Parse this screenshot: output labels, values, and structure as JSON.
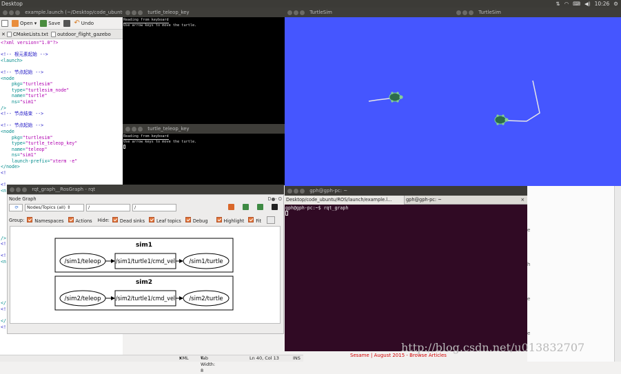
{
  "topbar": {
    "title": "Desktop",
    "time": "10:26"
  },
  "gedit": {
    "title": "example.launch (~/Desktop/code_ubuntu",
    "toolbar": {
      "open": "Open",
      "save": "Save",
      "undo": "Undo"
    },
    "tabs": [
      "CMakeLists.txt",
      "outdoor_flight_gazebo"
    ],
    "lines": [
      [
        [
          "<?xml version=\"1.0\"?>",
          "c-attr"
        ]
      ],
      [
        [
          "",
          ""
        ]
      ],
      [
        [
          "<!-- ",
          "c-cmt"
        ],
        [
          "根元素起始",
          "c-cmt"
        ],
        [
          " -->",
          "c-cmt"
        ]
      ],
      [
        [
          "<launch>",
          "c-tag"
        ]
      ],
      [
        [
          "",
          ""
        ]
      ],
      [
        [
          "<!-- ",
          "c-cmt"
        ],
        [
          "节点起始",
          "c-cmt"
        ],
        [
          " -->",
          "c-cmt"
        ]
      ],
      [
        [
          "<node",
          "c-tag"
        ]
      ],
      [
        [
          "    pkg=",
          "c-tag"
        ],
        [
          "\"turtlesim\"",
          "c-attr"
        ]
      ],
      [
        [
          "    type=",
          "c-tag"
        ],
        [
          "\"turtlesim_node\"",
          "c-attr"
        ]
      ],
      [
        [
          "    name=",
          "c-tag"
        ],
        [
          "\"turtle\"",
          "c-attr"
        ]
      ],
      [
        [
          "    ns=",
          "c-tag"
        ],
        [
          "\"sim1\"",
          "c-attr"
        ]
      ],
      [
        [
          "/>",
          "c-tag"
        ]
      ],
      [
        [
          "<!-- ",
          "c-cmt"
        ],
        [
          "节点结束",
          "c-cmt"
        ],
        [
          " -->",
          "c-cmt"
        ]
      ],
      [
        [
          "",
          ""
        ]
      ],
      [
        [
          "<!-- ",
          "c-cmt"
        ],
        [
          "节点起始",
          "c-cmt"
        ],
        [
          " -->",
          "c-cmt"
        ]
      ],
      [
        [
          "<node",
          "c-tag"
        ]
      ],
      [
        [
          "    pkg=",
          "c-tag"
        ],
        [
          "\"turtlesim\"",
          "c-attr"
        ]
      ],
      [
        [
          "    type=",
          "c-tag"
        ],
        [
          "\"turtle_teleop_key\"",
          "c-attr"
        ]
      ],
      [
        [
          "    name=",
          "c-tag"
        ],
        [
          "\"teleop\"",
          "c-attr"
        ]
      ],
      [
        [
          "    ns=",
          "c-tag"
        ],
        [
          "\"sim1\"",
          "c-attr"
        ]
      ],
      [
        [
          "    launch-prefix=",
          "c-tag"
        ],
        [
          "\"xterm -e\"",
          "c-attr"
        ]
      ],
      [
        [
          "</node>",
          "c-tag"
        ]
      ],
      [
        [
          "<!",
          "c-cmt"
        ]
      ],
      [
        [
          "",
          ""
        ]
      ],
      [
        [
          "<!",
          "c-cmt"
        ]
      ],
      [
        [
          "<n",
          "c-tag"
        ]
      ],
      [
        [
          "",
          ""
        ]
      ],
      [
        [
          "",
          ""
        ]
      ],
      [
        [
          "",
          ""
        ]
      ],
      [
        [
          "",
          ""
        ]
      ],
      [
        [
          "",
          ""
        ]
      ],
      [
        [
          "",
          ""
        ]
      ],
      [
        [
          "",
          ""
        ]
      ],
      [
        [
          "/>",
          "c-tag"
        ]
      ],
      [
        [
          "<!",
          "c-cmt"
        ]
      ],
      [
        [
          "",
          ""
        ]
      ],
      [
        [
          "<!",
          "c-cmt"
        ]
      ],
      [
        [
          "<n",
          "c-tag"
        ]
      ],
      [
        [
          "",
          ""
        ]
      ],
      [
        [
          "",
          ""
        ]
      ],
      [
        [
          "",
          ""
        ]
      ],
      [
        [
          "",
          ""
        ]
      ],
      [
        [
          "",
          ""
        ]
      ],
      [
        [
          "",
          ""
        ]
      ],
      [
        [
          "</",
          "c-tag"
        ]
      ],
      [
        [
          "<!",
          "c-cmt"
        ]
      ],
      [
        [
          "",
          ""
        ]
      ],
      [
        [
          "</",
          "c-tag"
        ]
      ],
      [
        [
          "<!",
          "c-cmt"
        ]
      ]
    ],
    "status": {
      "lang": "XML",
      "tab_width": "Tab Width: 8",
      "position": "Ln 40, Col 13",
      "mode": "INS"
    }
  },
  "teleop_1": {
    "title": "turtle_teleop_key",
    "line1": "Reading from keyboard",
    "line2": "Use arrow keys to move the turtle."
  },
  "teleop_2": {
    "title": "turtle_teleop_key",
    "line1": "Reading from keyboard",
    "line2": "Use arrow keys to move the turtle."
  },
  "turtlesim_1": {
    "title": "TurtleSim",
    "bg_color": "#4556ff"
  },
  "turtlesim_2": {
    "title": "TurtleSim",
    "bg_color": "#4556ff"
  },
  "rqt": {
    "title": "rqt_graph__RosGraph - rqt",
    "panel_title": "Node Graph",
    "panel_controls": "D●- O",
    "filter_select": "Nodes/Topics (all)",
    "filter1": "/",
    "filter2": "/",
    "group_label": "Group:",
    "hide_label": "Hide:",
    "checks": [
      "Namespaces",
      "Actions",
      "Dead sinks",
      "Leaf topics",
      "Debug",
      "Highlight",
      "Fit"
    ],
    "graph": {
      "groups": [
        {
          "name": "sim1",
          "src": "/sim1/teleop",
          "topic": "/sim1/turtle1/cmd_vel",
          "dst": "/sim1/turtle"
        },
        {
          "name": "sim2",
          "src": "/sim2/teleop",
          "topic": "/sim2/turtle1/cmd_vel",
          "dst": "/sim2/turtle"
        }
      ]
    }
  },
  "terminal": {
    "title": "gph@gph-pc: ~",
    "tab1": "Desktop/code_ubuntu/ROS/launch/example.l...",
    "tab2": "gph@gph-pc: ~",
    "tab_close": "×",
    "prompt": "gph@gph-pc:~$ rqt_graph"
  },
  "watermark": "http://blog.csdn.net/u013832707",
  "bottom_link": "Sesame | August 2015 - Browse Articles"
}
